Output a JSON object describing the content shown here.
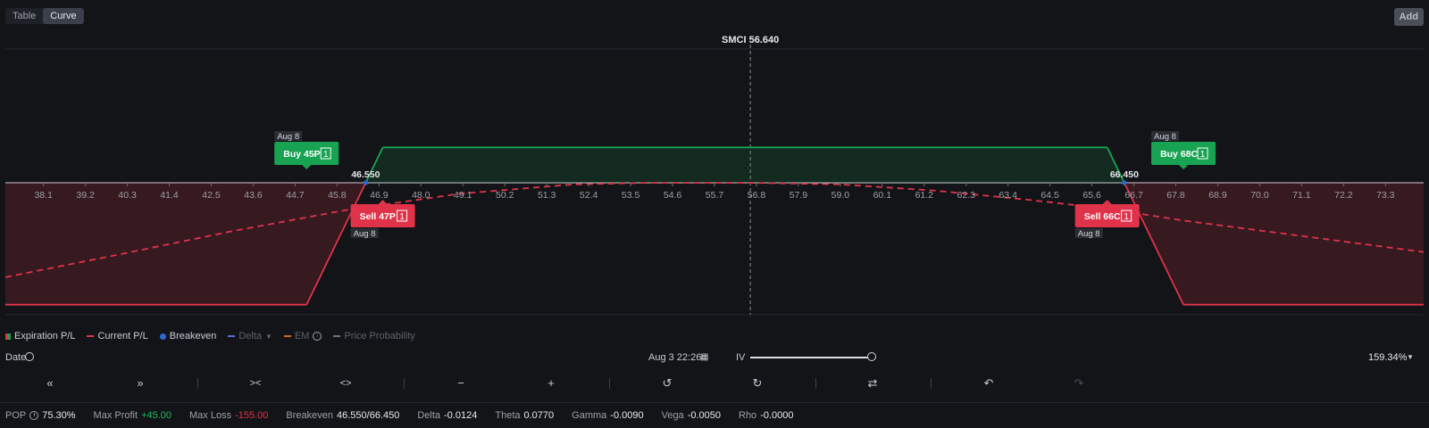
{
  "view_toggle": {
    "table_label": "Table",
    "curve_label": "Curve",
    "active": "Curve"
  },
  "add_label": "Add",
  "underlying_label": "SMCI 56.640",
  "chart_data": {
    "type": "line",
    "title": "",
    "xlabel": "",
    "ylabel": "",
    "xlim": [
      37.1,
      74.3
    ],
    "ylim": [
      -170,
      90
    ],
    "spot": 56.64,
    "x_ticks": [
      38.1,
      39.2,
      40.3,
      41.4,
      42.5,
      43.6,
      44.7,
      45.8,
      46.9,
      48.0,
      49.1,
      50.2,
      51.3,
      52.4,
      53.5,
      54.6,
      55.7,
      56.8,
      57.9,
      59.0,
      60.1,
      61.2,
      62.3,
      63.4,
      64.5,
      65.6,
      66.7,
      67.8,
      68.9,
      70.0,
      71.1,
      72.2,
      73.3
    ],
    "series": [
      {
        "name": "Expiration P/L",
        "style": "solid",
        "points": [
          [
            37.1,
            -155
          ],
          [
            45,
            -155
          ],
          [
            46.55,
            0
          ],
          [
            47,
            45
          ],
          [
            66,
            45
          ],
          [
            66.45,
            0
          ],
          [
            68,
            -155
          ],
          [
            74.3,
            -155
          ]
        ]
      },
      {
        "name": "Current P/L",
        "style": "dashed",
        "points": [
          [
            37.1,
            -120
          ],
          [
            40,
            -92
          ],
          [
            43,
            -62
          ],
          [
            46,
            -35
          ],
          [
            49,
            -14
          ],
          [
            52,
            -2
          ],
          [
            54,
            0
          ],
          [
            56.64,
            0
          ],
          [
            59,
            -2
          ],
          [
            61.5,
            -10
          ],
          [
            64,
            -22
          ],
          [
            66,
            -33
          ],
          [
            68,
            -48
          ],
          [
            71,
            -67
          ],
          [
            74.3,
            -88
          ]
        ]
      }
    ],
    "breakevens": [
      46.55,
      66.45
    ],
    "breakeven_labels": [
      "46.550",
      "66.450"
    ],
    "legs": [
      {
        "label": "Buy 45P",
        "qty": "1",
        "date": "Aug 8",
        "side": "buy",
        "strike": 45
      },
      {
        "label": "Sell 47P",
        "qty": "1",
        "date": "Aug 8",
        "side": "sell",
        "strike": 47
      },
      {
        "label": "Sell 66C",
        "qty": "1",
        "date": "Aug 8",
        "side": "sell",
        "strike": 66
      },
      {
        "label": "Buy 68C",
        "qty": "1",
        "date": "Aug 8",
        "side": "buy",
        "strike": 68
      }
    ],
    "colors": {
      "profit": "#18a352",
      "loss": "#e0334a",
      "breakeven": "#2d6ad6",
      "background": "#131418"
    },
    "grid": false
  },
  "legend": {
    "expiration": "Expiration P/L",
    "current": "Current P/L",
    "breakeven": "Breakeven",
    "delta": "Delta",
    "em": "EM",
    "probability": "Price Probability"
  },
  "controls": {
    "date_label": "Date",
    "date_value": "Aug 3 22:26",
    "iv_label": "IV",
    "iv_value": "159.34%",
    "iv_level": 0.8
  },
  "toolbar_icons": [
    "double-chevron-left-icon",
    "double-chevron-right-icon",
    "collapse-icon",
    "expand-icon",
    "minus-icon",
    "plus-icon",
    "history-back-icon",
    "history-forward-icon",
    "swap-icon",
    "undo-icon",
    "redo-icon"
  ],
  "stats": {
    "pop_label": "POP",
    "pop_value": "75.30%",
    "max_profit_label": "Max Profit",
    "max_profit_value": "+45.00",
    "max_loss_label": "Max Loss",
    "max_loss_value": "-155.00",
    "breakeven_label": "Breakeven",
    "breakeven_value": "46.550/66.450",
    "delta_label": "Delta",
    "delta_value": "-0.0124",
    "theta_label": "Theta",
    "theta_value": "0.0770",
    "gamma_label": "Gamma",
    "gamma_value": "-0.0090",
    "vega_label": "Vega",
    "vega_value": "-0.0050",
    "rho_label": "Rho",
    "rho_value": "-0.0000"
  }
}
